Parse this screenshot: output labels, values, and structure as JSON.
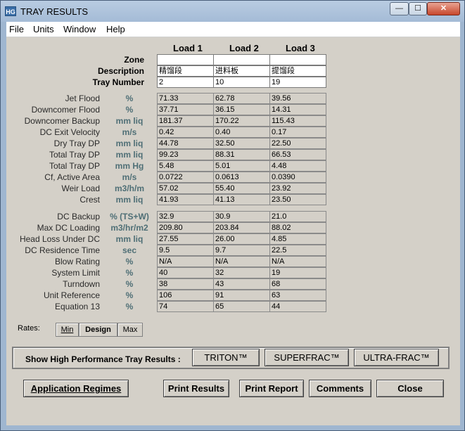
{
  "window": {
    "icon_text": "HG",
    "title": "TRAY RESULTS",
    "min_glyph": "—",
    "max_glyph": "☐",
    "close_glyph": "✕"
  },
  "menu": [
    "File",
    "Units",
    "Window",
    "Help"
  ],
  "loads": [
    "Load 1",
    "Load 2",
    "Load 3"
  ],
  "header_rows": [
    {
      "label": "Zone",
      "values": [
        "",
        "",
        ""
      ]
    },
    {
      "label": "Description",
      "values": [
        "精馏段",
        "进料板",
        "提馏段"
      ]
    },
    {
      "label": "Tray Number",
      "values": [
        "2",
        "10",
        "19"
      ]
    }
  ],
  "group1": [
    {
      "label": "Jet Flood",
      "unit": "%",
      "values": [
        "71.33",
        "62.78",
        "39.56"
      ]
    },
    {
      "label": "Downcomer Flood",
      "unit": "%",
      "values": [
        "37.71",
        "36.15",
        "14.31"
      ]
    },
    {
      "label": "Downcomer Backup",
      "unit": "mm liq",
      "values": [
        "181.37",
        "170.22",
        "115.43"
      ]
    },
    {
      "label": "DC Exit Velocity",
      "unit": "m/s",
      "values": [
        "0.42",
        "0.40",
        "0.17"
      ]
    },
    {
      "label": "Dry Tray DP",
      "unit": "mm liq",
      "values": [
        "44.78",
        "32.50",
        "22.50"
      ]
    },
    {
      "label": "Total Tray DP",
      "unit": "mm liq",
      "values": [
        "99.23",
        "88.31",
        "66.53"
      ]
    },
    {
      "label": "Total Tray DP",
      "unit": "mm Hg",
      "values": [
        "5.48",
        "5.01",
        "4.48"
      ]
    },
    {
      "label": "Cf, Active Area",
      "unit": "m/s",
      "values": [
        "0.0722",
        "0.0613",
        "0.0390"
      ]
    },
    {
      "label": "Weir Load",
      "unit": "m3/h/m",
      "values": [
        "57.02",
        "55.40",
        "23.92"
      ]
    },
    {
      "label": "Crest",
      "unit": "mm liq",
      "values": [
        "41.93",
        "41.13",
        "23.50"
      ]
    }
  ],
  "group2": [
    {
      "label": "DC Backup",
      "unit": "% (TS+W)",
      "values": [
        "32.9",
        "30.9",
        "21.0"
      ]
    },
    {
      "label": "Max DC Loading",
      "unit": "m3/hr/m2",
      "values": [
        "209.80",
        "203.84",
        "88.02"
      ]
    },
    {
      "label": "Head Loss Under DC",
      "unit": "mm liq",
      "values": [
        "27.55",
        "26.00",
        "4.85"
      ]
    },
    {
      "label": "DC Residence Time",
      "unit": "sec",
      "values": [
        "9.5",
        "9.7",
        "22.5"
      ]
    },
    {
      "label": "Blow Rating",
      "unit": "%",
      "values": [
        "N/A",
        "N/A",
        "N/A"
      ]
    },
    {
      "label": "System Limit",
      "unit": "%",
      "values": [
        "40",
        "32",
        "19"
      ]
    },
    {
      "label": "Turndown",
      "unit": "%",
      "values": [
        "38",
        "43",
        "68"
      ]
    },
    {
      "label": "Unit Reference",
      "unit": "%",
      "values": [
        "106",
        "91",
        "63"
      ]
    },
    {
      "label": "Equation 13",
      "unit": "%",
      "values": [
        "74",
        "65",
        "44"
      ]
    }
  ],
  "rates": {
    "label": "Rates:",
    "options": [
      "Min",
      "Design",
      "Max"
    ],
    "selected": "Design"
  },
  "high_performance": {
    "label": "Show High Performance Tray Results :",
    "buttons": [
      "TRITON™",
      "SUPERFRAC™",
      "ULTRA-FRAC™"
    ]
  },
  "bottom_buttons": [
    "Application Regimes",
    "Print Results",
    "Print Report",
    "Comments",
    "Close"
  ],
  "colors": {
    "unit_text": "#4f6f76",
    "panel_bg": "#d4d0c8",
    "frame": "#9fb6d0"
  }
}
